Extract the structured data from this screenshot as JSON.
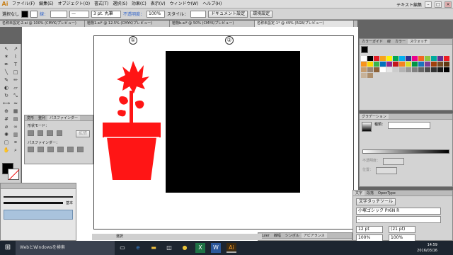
{
  "app": {
    "logo": "Ai",
    "accent": "#c8821e"
  },
  "menu": [
    "ファイル(F)",
    "編集(E)",
    "オブジェクト(O)",
    "書式(T)",
    "選択(S)",
    "効果(C)",
    "表示(V)",
    "ウィンドウ(W)",
    "ヘルプ(H)"
  ],
  "workspace": "テキスト編集",
  "control": {
    "selection": "選択なし",
    "stroke_label": "線：",
    "stroke_value": "3 pt. 丸筆",
    "opacity_label": "不透明度：",
    "opacity_value": "100%",
    "style_label": "スタイル：",
    "doc_settings": "ドキュメント設定",
    "env_settings": "環境設定"
  },
  "doc_tabs": [
    "名称未設定-2.ai @ 100% (CMYK/プレビュー)",
    "植物1.ai* @ 12.5% (CMYK/プレビュー)",
    "植物b.ai* @ 50% (CMYK/プレビュー)",
    "名称未設定-1* @ 49% (RGB/プレビュー)"
  ],
  "artboard": {
    "label1": "①",
    "label2": "②",
    "plant_color": "#ff1515",
    "rect_color": "#000000"
  },
  "pathfinder": {
    "tabs": [
      "変形",
      "整列",
      "パスファインダー"
    ],
    "shape_mode": "形状モード：",
    "expand": "拡張",
    "pathfinder_label": "パスファインダー："
  },
  "swatch_panel": {
    "tabs": [
      "カラーガイド",
      "線",
      "カラー",
      "スウォッチ"
    ]
  },
  "gradient_panel": {
    "tabs": [
      "グラデーション"
    ],
    "type_label": "種類：",
    "opacity_label": "不透明度：",
    "location_label": "位置："
  },
  "brush_panel": {
    "label": "基本"
  },
  "char_panel": {
    "tabs": [
      "文字",
      "段落",
      "OpenType"
    ],
    "touch_tool": "文字タッチツール",
    "font": "小塚ゴシック Pr6N R",
    "size": "12 pt",
    "leading": "(21 pt)",
    "scale": "100%"
  },
  "bottom_panel": {
    "tabs": [
      "Kuler",
      "線幅",
      "シンボル",
      "アピアランス"
    ]
  },
  "status": {
    "mode": "選択"
  },
  "taskbar": {
    "search": "WebとWindowsを検索",
    "time": "14:59",
    "date": "2016/03/16"
  }
}
